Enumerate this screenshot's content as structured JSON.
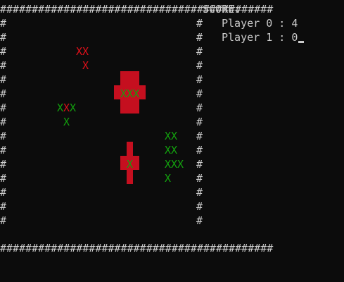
{
  "board": {
    "top_border": "###########################################",
    "bottom_border": "###########################################",
    "side_char": "#",
    "rows": 15
  },
  "score": {
    "header": "SCORE:",
    "players": [
      {
        "label": "Player 0 : 4"
      },
      {
        "label": "Player 1 : 0"
      }
    ]
  },
  "marks": [
    {
      "text": "XX",
      "color": "red"
    },
    {
      "text": "X",
      "color": "red"
    },
    {
      "text": "XXX",
      "color": "green"
    },
    {
      "text": "X",
      "color": "green"
    },
    {
      "text": "X",
      "color": "red"
    },
    {
      "text": "X",
      "color": "green"
    },
    {
      "text": "X",
      "color": "green"
    },
    {
      "text": "XX",
      "color": "green"
    },
    {
      "text": "XX",
      "color": "green"
    },
    {
      "text": "X",
      "color": "green"
    },
    {
      "text": "XXX",
      "color": "green"
    },
    {
      "text": "X",
      "color": "green"
    }
  ],
  "colors": {
    "background": "#0c0c0c",
    "text": "#cccccc",
    "block_red": "#c50f1f",
    "mark_red": "#e0101a",
    "mark_green": "#13a10e"
  }
}
